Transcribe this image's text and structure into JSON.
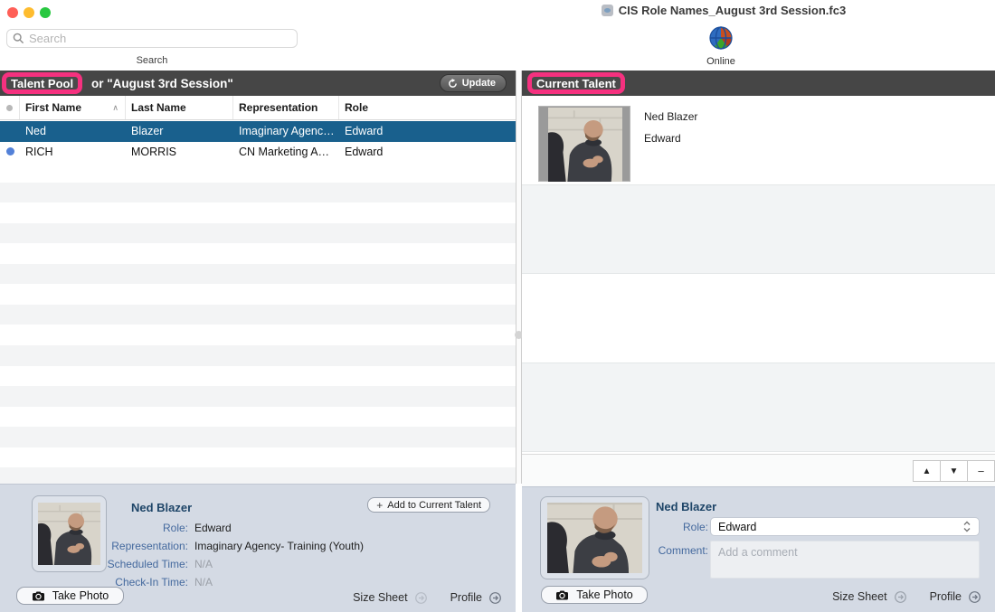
{
  "window": {
    "title": "CIS Role Names_August 3rd Session.fc3",
    "online_label": "Online"
  },
  "toolbar": {
    "search_placeholder": "Search",
    "search_item_label": "Search"
  },
  "icons": {
    "up_glyph": "▲",
    "down_glyph": "▼",
    "remove_glyph": "−",
    "plus_glyph": "+",
    "sort_asc_glyph": "∧"
  },
  "colors": {
    "annotation_pink": "#f5317f",
    "panel_header_gray": "#464646",
    "selection_blue": "#19608d",
    "detail_panel_bg": "#d4dae4",
    "label_blue": "#44699e",
    "status_dot_blue": "#5381d8"
  },
  "talent_pool": {
    "highlight_label": "Talent Pool",
    "title_rest": "or \"August 3rd Session\"",
    "update_button": "Update",
    "columns": {
      "first": "First Name",
      "last": "Last Name",
      "rep": "Representation",
      "role": "Role"
    },
    "rows": [
      {
        "first": "Ned",
        "last": "Blazer",
        "rep": "Imaginary Agenc…",
        "role": "Edward",
        "selected": true,
        "dot": false
      },
      {
        "first": "RICH",
        "last": "MORRIS",
        "rep": "CN Marketing A…",
        "role": "Edward",
        "selected": false,
        "dot": true
      }
    ],
    "empty_row_count": 16
  },
  "current_talent": {
    "highlight_label": "Current Talent",
    "entries": [
      {
        "name": "Ned Blazer",
        "role": "Edward"
      }
    ]
  },
  "pool_detail": {
    "name": "Ned Blazer",
    "fields": [
      {
        "label": "Role:",
        "value": "Edward",
        "muted": false
      },
      {
        "label": "Representation:",
        "value": "Imaginary Agency- Training (Youth)",
        "muted": false
      },
      {
        "label": "Scheduled Time:",
        "value": "N/A",
        "muted": true
      },
      {
        "label": "Check-In Time:",
        "value": "N/A",
        "muted": true
      }
    ],
    "take_photo_button": "Take Photo",
    "add_button_label": "Add to Current Talent",
    "size_sheet_label": "Size Sheet",
    "profile_label": "Profile"
  },
  "talent_detail": {
    "name": "Ned Blazer",
    "role_label": "Role:",
    "role_value": "Edward",
    "comment_label": "Comment:",
    "comment_placeholder": "Add a comment",
    "take_photo_button": "Take Photo",
    "size_sheet_label": "Size Sheet",
    "profile_label": "Profile"
  }
}
